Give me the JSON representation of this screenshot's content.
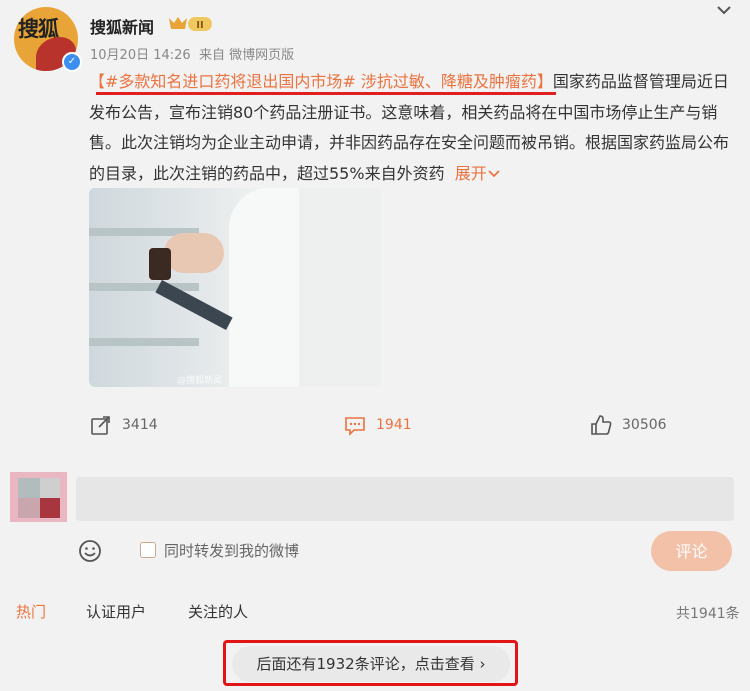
{
  "account": {
    "logo_text": "搜狐",
    "name": "搜狐新闻",
    "badge": "II",
    "date": "10月20日 14:26",
    "source": "来自 微博网页版"
  },
  "post": {
    "hashtag": "【#多款知名进口药将退出国内市场#",
    "topic": " 涉抗过敏、降糖及肿瘤药】",
    "body": "国家药品监督管理局近日发布公告，宣布注销80个药品注册证书。这意味着，相关药品将在中国市场停止生产与销售。此次注销均为企业主动申请，并非因药品存在安全问题而被吊销。根据国家药监局公布的目录，此次注销的药品中，超过55%来自外资药",
    "expand": "展开",
    "image_watermark": "@搜狐新闻"
  },
  "actions": {
    "forward_count": "3414",
    "comment_count": "1941",
    "like_count": "30506"
  },
  "comment_box": {
    "forward_option": "同时转发到我的微博",
    "submit": "评论"
  },
  "tabs": {
    "hot": "热门",
    "verified": "认证用户",
    "following": "关注的人",
    "total": "共1941条"
  },
  "more": {
    "label": "后面还有1932条评论，点击查看 ›"
  },
  "colors": {
    "accent": "#eb7340",
    "highlight_red": "#e01515",
    "verify_blue": "#3b8ff0"
  }
}
